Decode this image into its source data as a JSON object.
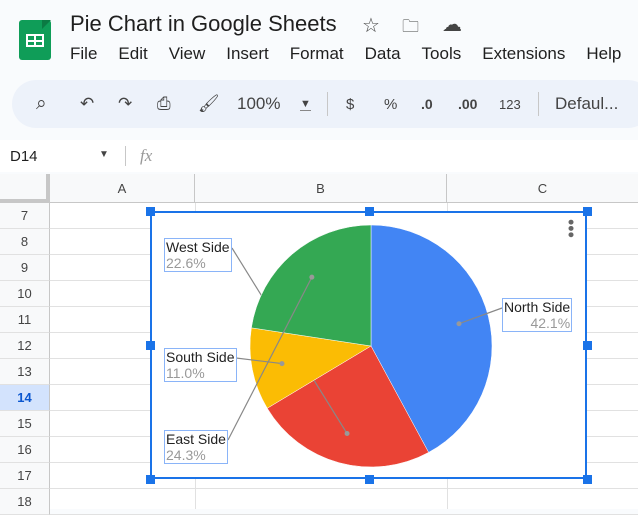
{
  "app": {
    "title": "Pie Chart in Google Sheets",
    "title_icons": [
      "star-icon",
      "move-folder-icon",
      "cloud-saved-icon"
    ]
  },
  "menu": [
    "File",
    "Edit",
    "View",
    "Insert",
    "Format",
    "Data",
    "Tools",
    "Extensions",
    "Help"
  ],
  "toolbar": {
    "zoom": "100%",
    "currency": "$",
    "percent": "%",
    "decrease_decimal": ".0",
    "increase_decimal": ".00",
    "number_format": "123",
    "font": "Defaul..."
  },
  "formula_bar": {
    "cell_ref": "D14",
    "fx": "fx",
    "value": ""
  },
  "columns": [
    "A",
    "B",
    "C"
  ],
  "rows": [
    "7",
    "8",
    "9",
    "10",
    "11",
    "12",
    "13",
    "14",
    "15",
    "16",
    "17",
    "18"
  ],
  "selected_row": "14",
  "colors": {
    "north": "#4285f4",
    "east": "#ea4335",
    "south": "#fbbc04",
    "west": "#34a853",
    "selection": "#1a73e8"
  },
  "chart_data": {
    "type": "pie",
    "title": "",
    "start_angle": 0,
    "direction": "clockwise",
    "slices": [
      {
        "label": "North Side",
        "value": 42.1,
        "display": "42.1%",
        "color": "#4285f4"
      },
      {
        "label": "East Side",
        "value": 24.3,
        "display": "24.3%",
        "color": "#ea4335"
      },
      {
        "label": "South Side",
        "value": 11.0,
        "display": "11.0%",
        "color": "#fbbc04"
      },
      {
        "label": "West Side",
        "value": 22.6,
        "display": "22.6%",
        "color": "#34a853"
      }
    ],
    "legend": "labeled"
  }
}
